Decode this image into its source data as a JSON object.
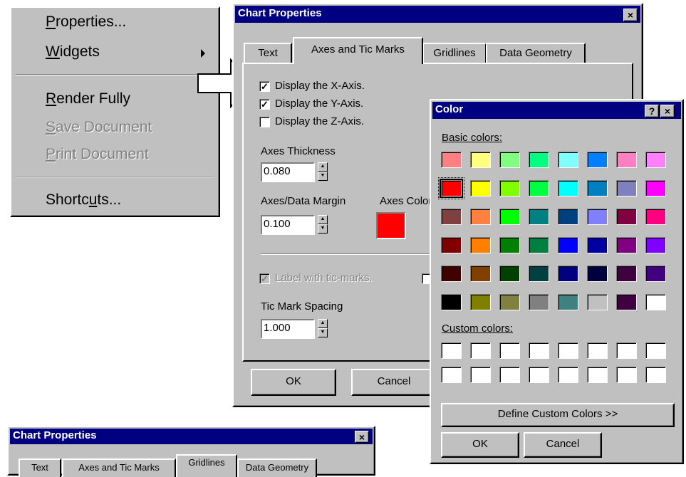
{
  "context_menu": {
    "items": [
      "Properties...",
      "Widgets",
      "Render Fully",
      "Save Document",
      "Print Document",
      "Shortcuts..."
    ]
  },
  "chart_dialog": {
    "title": "Chart Properties",
    "close_label": "×",
    "tabs": [
      "Text",
      "Axes and Tic Marks",
      "Gridlines",
      "Data Geometry"
    ],
    "display_x": "Display the X-Axis.",
    "display_y": "Display the Y-Axis.",
    "display_z": "Display the Z-Axis.",
    "axes_thickness_label": "Axes Thickness",
    "axes_thickness_value": "0.080",
    "axes_data_margin_label": "Axes/Data Margin",
    "axes_data_margin_value": "0.100",
    "axes_color_label": "Axes Color",
    "axes_color": "#ff0000",
    "label_tic_marks": "Label with tic-marks.",
    "tic_spacing_label": "Tic Mark Spacing",
    "tic_spacing_value": "1.000",
    "ok_label": "OK",
    "cancel_label": "Cancel"
  },
  "color_dialog": {
    "title": "Color",
    "help_label": "?",
    "close_label": "×",
    "basic_colors_label": "Basic colors:",
    "custom_colors_label": "Custom colors:",
    "define_custom_label": "Define Custom Colors >>",
    "ok_label": "OK",
    "cancel_label": "Cancel",
    "basic_colors": [
      [
        "#ff8080",
        "#ffff80",
        "#80ff80",
        "#00ff80",
        "#80ffff",
        "#0080ff",
        "#ff80c0",
        "#ff80ff"
      ],
      [
        "#ff0000",
        "#ffff00",
        "#80ff00",
        "#00ff40",
        "#00ffff",
        "#0080c0",
        "#8080c0",
        "#ff00ff"
      ],
      [
        "#804040",
        "#ff8040",
        "#00ff00",
        "#008080",
        "#004080",
        "#8080ff",
        "#800040",
        "#ff0080"
      ],
      [
        "#800000",
        "#ff8000",
        "#008000",
        "#008040",
        "#0000ff",
        "#0000a0",
        "#800080",
        "#8000ff"
      ],
      [
        "#400000",
        "#804000",
        "#004000",
        "#004040",
        "#000080",
        "#000040",
        "#400040",
        "#400080"
      ],
      [
        "#000000",
        "#808000",
        "#808040",
        "#808080",
        "#408080",
        "#c0c0c0",
        "#400040",
        "#ffffff"
      ]
    ],
    "custom_colors": [
      [
        "#ffffff",
        "#ffffff",
        "#ffffff",
        "#ffffff",
        "#ffffff",
        "#ffffff",
        "#ffffff",
        "#ffffff"
      ],
      [
        "#ffffff",
        "#ffffff",
        "#ffffff",
        "#ffffff",
        "#ffffff",
        "#ffffff",
        "#ffffff",
        "#ffffff"
      ]
    ]
  },
  "bottom_dialog": {
    "title": "Chart Properties",
    "close_label": "×",
    "tabs": [
      "Text",
      "Axes and Tic Marks",
      "Gridlines",
      "Data Geometry"
    ]
  }
}
